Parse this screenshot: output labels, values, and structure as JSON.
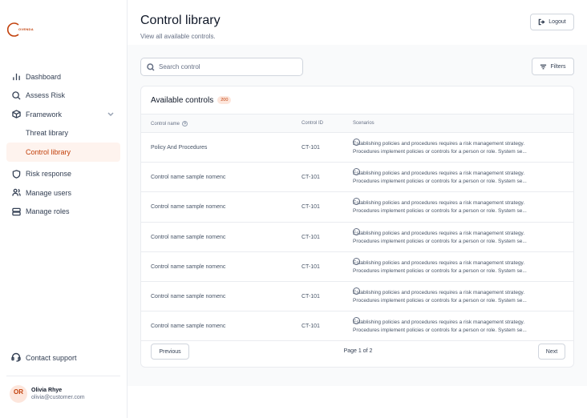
{
  "brand": {
    "logo_text": "OVENDA"
  },
  "sidebar": {
    "items": [
      {
        "label": "Dashboard"
      },
      {
        "label": "Assess Risk"
      },
      {
        "label": "Framework"
      },
      {
        "label": "Threat library"
      },
      {
        "label": "Control library"
      },
      {
        "label": "Risk response"
      },
      {
        "label": "Manage users"
      },
      {
        "label": "Manage roles"
      }
    ],
    "support": "Contact support",
    "user": {
      "initials": "OR",
      "name": "Olivia Rhye",
      "email": "olivia@customer.com"
    }
  },
  "header": {
    "title": "Control library",
    "subtitle": "View all available controls.",
    "logout": "Logout"
  },
  "toolbar": {
    "search_placeholder": "Search control",
    "filters": "Filters"
  },
  "card": {
    "title": "Available controls",
    "count": "200",
    "columns": [
      "Control name",
      "Control ID",
      "Scenarios"
    ],
    "rows": [
      {
        "name": "Policy And Procedures",
        "id": "CT-101",
        "line1": "Establishing policies and procedures requires a risk management strategy.",
        "line2": "Procedures implement policies or controls for a person or role. System se..."
      },
      {
        "name": "Control name sample nomenc",
        "id": "CT-101",
        "line1": "Establishing policies and procedures requires a risk management strategy.",
        "line2": "Procedures implement policies or controls for a person or role. System se..."
      },
      {
        "name": "Control name sample nomenc",
        "id": "CT-101",
        "line1": "Establishing policies and procedures requires a risk management strategy.",
        "line2": "Procedures implement policies or controls for a person or role. System se..."
      },
      {
        "name": "Control name sample nomenc",
        "id": "CT-101",
        "line1": "Establishing policies and procedures requires a risk management strategy.",
        "line2": "Procedures implement policies or controls for a person or role. System se..."
      },
      {
        "name": "Control name sample nomenc",
        "id": "CT-101",
        "line1": "Establishing policies and procedures requires a risk management strategy.",
        "line2": "Procedures implement policies or controls for a person or role. System se..."
      },
      {
        "name": "Control name sample nomenc",
        "id": "CT-101",
        "line1": "Establishing policies and procedures requires a risk management strategy.",
        "line2": "Procedures implement policies or controls for a person or role. System se..."
      },
      {
        "name": "Control name sample nomenc",
        "id": "CT-101",
        "line1": "Establishing policies and procedures requires a risk management strategy.",
        "line2": "Procedures implement policies or controls for a person or role. System se..."
      }
    ],
    "pager": {
      "prev": "Previous",
      "info": "Page 1 of 2",
      "next": "Next"
    }
  },
  "colors": {
    "accent": "#c2410c",
    "accent_bg": "#fef3ee"
  }
}
